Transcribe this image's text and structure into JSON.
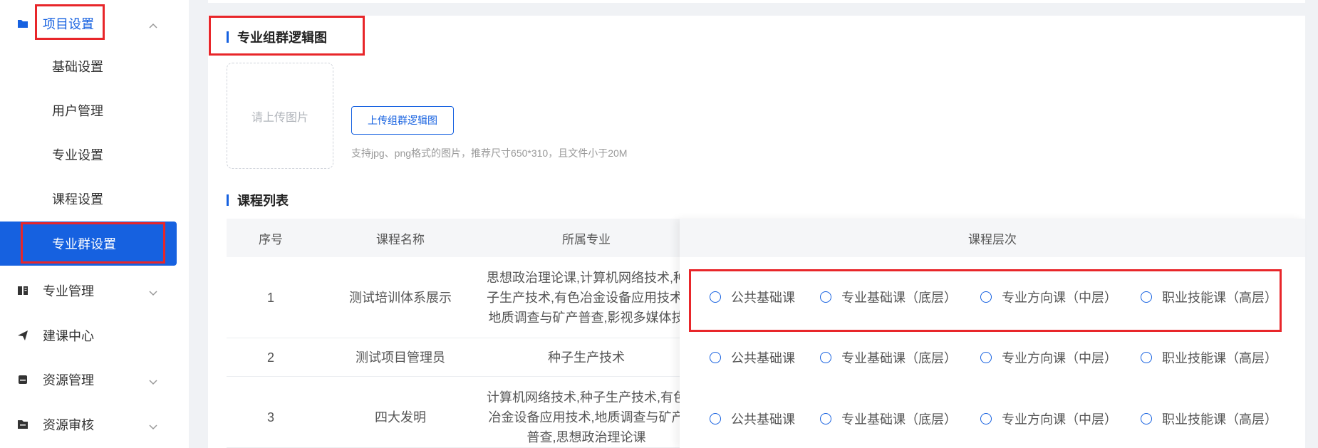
{
  "sidebar": {
    "groups": [
      {
        "label": "项目设置",
        "icon": "folder-icon",
        "open": true
      },
      {
        "label": "专业管理",
        "icon": "book-icon"
      },
      {
        "label": "建课中心",
        "icon": "send-icon"
      },
      {
        "label": "资源管理",
        "icon": "inbox-icon"
      },
      {
        "label": "资源审核",
        "icon": "audit-icon"
      }
    ],
    "sub_items": [
      {
        "label": "基础设置"
      },
      {
        "label": "用户管理"
      },
      {
        "label": "专业设置"
      },
      {
        "label": "课程设置"
      },
      {
        "label": "专业群设置",
        "active": true
      }
    ]
  },
  "logic_section": {
    "title": "专业组群逻辑图",
    "upload_placeholder": "请上传图片",
    "upload_button": "上传组群逻辑图",
    "hint": "支持jpg、png格式的图片，推荐尺寸650*310，且文件小于20M"
  },
  "course_section": {
    "title": "课程列表",
    "columns": {
      "index": "序号",
      "name": "课程名称",
      "major": "所属专业",
      "level": "课程层次"
    },
    "level_options": [
      "公共基础课",
      "专业基础课（底层）",
      "专业方向课（中层）",
      "职业技能课（高层）"
    ],
    "rows": [
      {
        "index": "1",
        "name": "测试培训体系展示",
        "major": "思想政治理论课,计算机网络技术,种子生产技术,有色冶金设备应用技术,地质调查与矿产普查,影视多媒体技术"
      },
      {
        "index": "2",
        "name": "测试项目管理员",
        "major": "种子生产技术"
      },
      {
        "index": "3",
        "name": "四大发明",
        "major": "计算机网络技术,种子生产技术,有色冶金设备应用技术,地质调查与矿产普查,思想政治理论课"
      }
    ]
  },
  "colors": {
    "accent": "#1661e0",
    "highlight": "#e8262a"
  }
}
